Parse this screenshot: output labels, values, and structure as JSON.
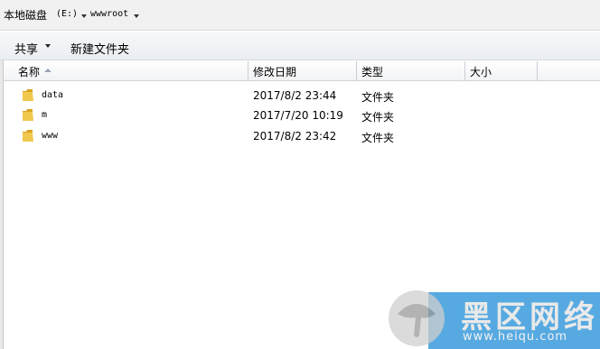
{
  "address": {
    "drive": "本地磁盘",
    "drive_letter": "(E:)",
    "folder": "wwwroot"
  },
  "toolbar": {
    "share": "共享",
    "new_folder": "新建文件夹"
  },
  "columns": {
    "name": "名称",
    "date": "修改日期",
    "type": "类型",
    "size": "大小"
  },
  "files": [
    {
      "name": "data",
      "date": "2017/8/2 23:44",
      "type": "文件夹"
    },
    {
      "name": "m",
      "date": "2017/7/20 10:19",
      "type": "文件夹"
    },
    {
      "name": "www",
      "date": "2017/8/2 23:42",
      "type": "文件夹"
    }
  ],
  "watermark": {
    "title": "黑区网络",
    "url": "www.heiqu.com"
  },
  "colors": {
    "folder": "#e8c04a",
    "watermark_band": "#3a9bdc"
  },
  "icons": {
    "folder": "folder-icon",
    "sort": "sort-ascending-icon",
    "breadcrumb_separator": "chevron-down-icon"
  }
}
